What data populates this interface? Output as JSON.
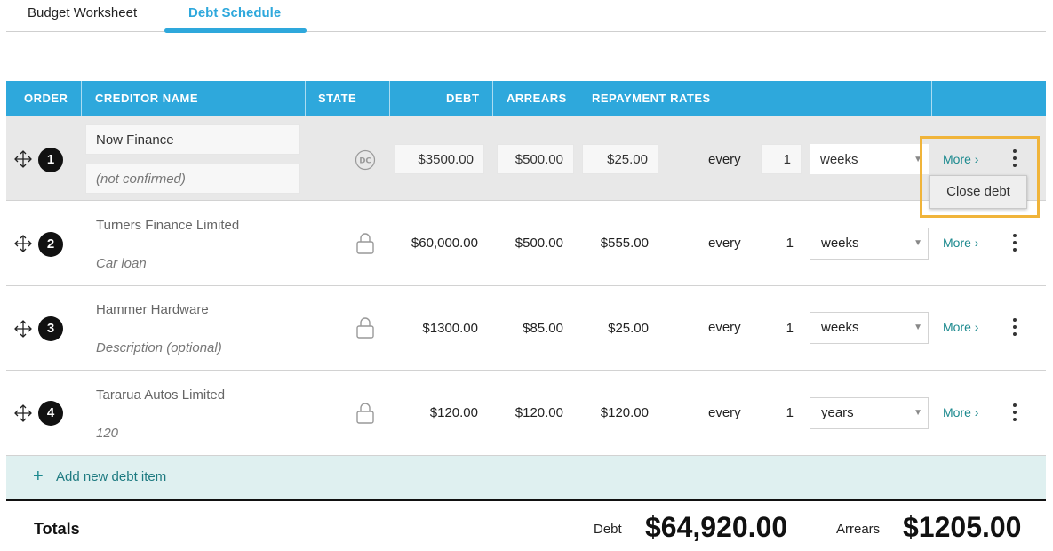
{
  "tabs": [
    {
      "label": "Budget Worksheet",
      "active": false
    },
    {
      "label": "Debt Schedule",
      "active": true
    }
  ],
  "header": {
    "order": "ORDER",
    "creditor_name": "CREDITOR NAME",
    "state": "STATE",
    "debt": "DEBT",
    "arrears": "ARREARS",
    "repayment_rates": "REPAYMENT RATES"
  },
  "rows": [
    {
      "order": "1",
      "creditor": "Now Finance",
      "description": "(not confirmed)",
      "state_icon": "dc-badge-icon",
      "state_text": "DC",
      "debt": "$3500.00",
      "arrears": "$500.00",
      "rate": "$25.00",
      "every": "every",
      "frequency": "1",
      "period": "weeks",
      "more": "More",
      "editable": true
    },
    {
      "order": "2",
      "creditor": "Turners Finance Limited",
      "description": "Car loan",
      "state_icon": "lock-icon",
      "debt": "$60,000.00",
      "arrears": "$500.00",
      "rate": "$555.00",
      "every": "every",
      "frequency": "1",
      "period": "weeks",
      "more": "More",
      "editable": false
    },
    {
      "order": "3",
      "creditor": "Hammer Hardware",
      "description": "Description (optional)",
      "state_icon": "lock-icon",
      "debt": "$1300.00",
      "arrears": "$85.00",
      "rate": "$25.00",
      "every": "every",
      "frequency": "1",
      "period": "weeks",
      "more": "More",
      "editable": false
    },
    {
      "order": "4",
      "creditor": "Tararua Autos Limited",
      "description": "120",
      "state_icon": "lock-icon",
      "debt": "$120.00",
      "arrears": "$120.00",
      "rate": "$120.00",
      "every": "every",
      "frequency": "1",
      "period": "years",
      "more": "More",
      "editable": false
    }
  ],
  "context_menu": {
    "close_debt": "Close debt"
  },
  "add_item": {
    "label": "Add new debt item"
  },
  "totals": {
    "label": "Totals",
    "debt_label": "Debt",
    "debt_value": "$64,920.00",
    "arrears_label": "Arrears",
    "arrears_value": "$1205.00"
  },
  "colors": {
    "accent": "#2ea8dc",
    "link": "#1d8a8f",
    "highlight": "#f0b43a",
    "add_row_bg": "#dff0f0"
  }
}
